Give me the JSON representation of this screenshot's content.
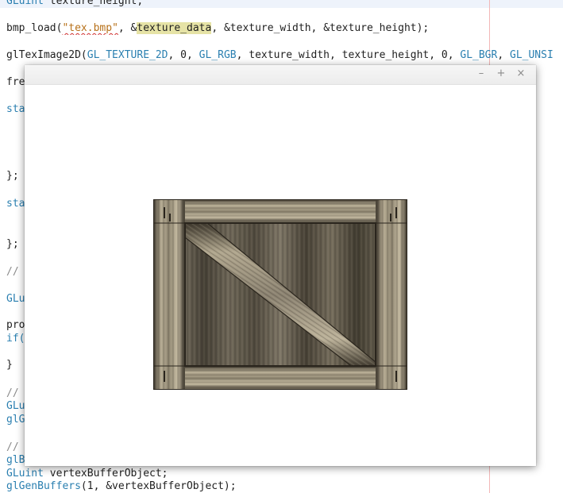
{
  "editor": {
    "lines": {
      "l0": [
        {
          "t": "GLuint",
          "c": "kw"
        },
        {
          "t": " texture_height;",
          "c": ""
        }
      ],
      "l1": [
        {
          "t": "bmp_load(",
          "c": ""
        },
        {
          "t": "\"tex.bmp\"",
          "c": "str squig"
        },
        {
          "t": ", &",
          "c": ""
        },
        {
          "t": "texture_data",
          "c": "hl"
        },
        {
          "t": ", &texture_width, &texture_height);",
          "c": ""
        }
      ],
      "l2": [
        {
          "t": "glTexImage2D(",
          "c": ""
        },
        {
          "t": "GL_TEXTURE_2D",
          "c": "kw"
        },
        {
          "t": ", 0, ",
          "c": ""
        },
        {
          "t": "GL_RGB",
          "c": "kw"
        },
        {
          "t": ", texture_width, texture_height, 0, ",
          "c": ""
        },
        {
          "t": "GL_BGR",
          "c": "kw"
        },
        {
          "t": ", ",
          "c": ""
        },
        {
          "t": "GL_UNSI",
          "c": "kw"
        }
      ],
      "l3": [
        {
          "t": "fre",
          "c": ""
        }
      ],
      "l4": [
        {
          "t": "sta",
          "c": "kw"
        }
      ],
      "l5": [
        {
          "t": "};",
          "c": ""
        }
      ],
      "l6": [
        {
          "t": "sta",
          "c": "kw"
        }
      ],
      "l7": [
        {
          "t": "};",
          "c": ""
        }
      ],
      "l8": [
        {
          "t": "//",
          "c": "cm"
        }
      ],
      "l9": [
        {
          "t": "GLu",
          "c": "kw"
        }
      ],
      "l10": [
        {
          "t": "pro",
          "c": ""
        }
      ],
      "l11": [
        {
          "t": "if(",
          "c": "kw"
        }
      ],
      "l12": [
        {
          "t": "}",
          "c": ""
        }
      ],
      "l13": [
        {
          "t": "//",
          "c": "cm"
        }
      ],
      "l14": [
        {
          "t": "GLu",
          "c": "kw"
        }
      ],
      "l15": [
        {
          "t": "glG",
          "c": "kw"
        }
      ],
      "l16": [
        {
          "t": "//",
          "c": "cm"
        }
      ],
      "l17": [
        {
          "t": "glB",
          "c": "kw"
        }
      ],
      "l18": [
        {
          "t": "GLuint",
          "c": "kw"
        },
        {
          "t": " vertexBufferObject;",
          "c": ""
        }
      ],
      "l19": [
        {
          "t": "glGenBuffers",
          "c": "kw"
        },
        {
          "t": "(1, &vertexBufferObject);",
          "c": ""
        }
      ]
    }
  },
  "window": {
    "minimize_label": "–",
    "maximize_label": "+",
    "close_label": "×"
  },
  "colors": {
    "keyword": "#2a7fb0",
    "string": "#b7711a",
    "highlight": "#e6e3a6",
    "margin_line": "#f2b8b8"
  }
}
